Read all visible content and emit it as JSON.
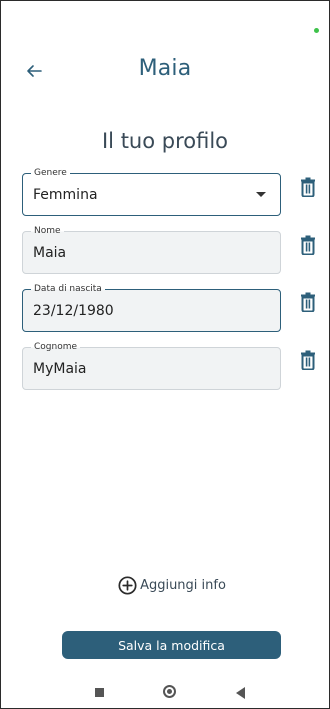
{
  "header": {
    "title": "Maia",
    "back_icon": "arrow-left-icon"
  },
  "section_title": "Il tuo profilo",
  "fields": [
    {
      "label": "Genere",
      "value": "Femmina",
      "type": "select"
    },
    {
      "label": "Nome",
      "value": "Maia",
      "type": "text"
    },
    {
      "label": "Data di nascita",
      "value": "23/12/1980",
      "type": "date"
    },
    {
      "label": "Cognome",
      "value": "MyMaia",
      "type": "text"
    }
  ],
  "delete_icon": "trash-icon",
  "add_info": {
    "label": "Aggiungi info",
    "icon": "plus-circle-icon"
  },
  "save_button": {
    "label": "Salva la modifica"
  },
  "colors": {
    "accent": "#2d5f7a",
    "status_dot": "#3ec24a",
    "field_bg": "#f1f3f4"
  },
  "navbar": {
    "icons": [
      "recent-apps-icon",
      "home-icon",
      "back-icon"
    ]
  }
}
